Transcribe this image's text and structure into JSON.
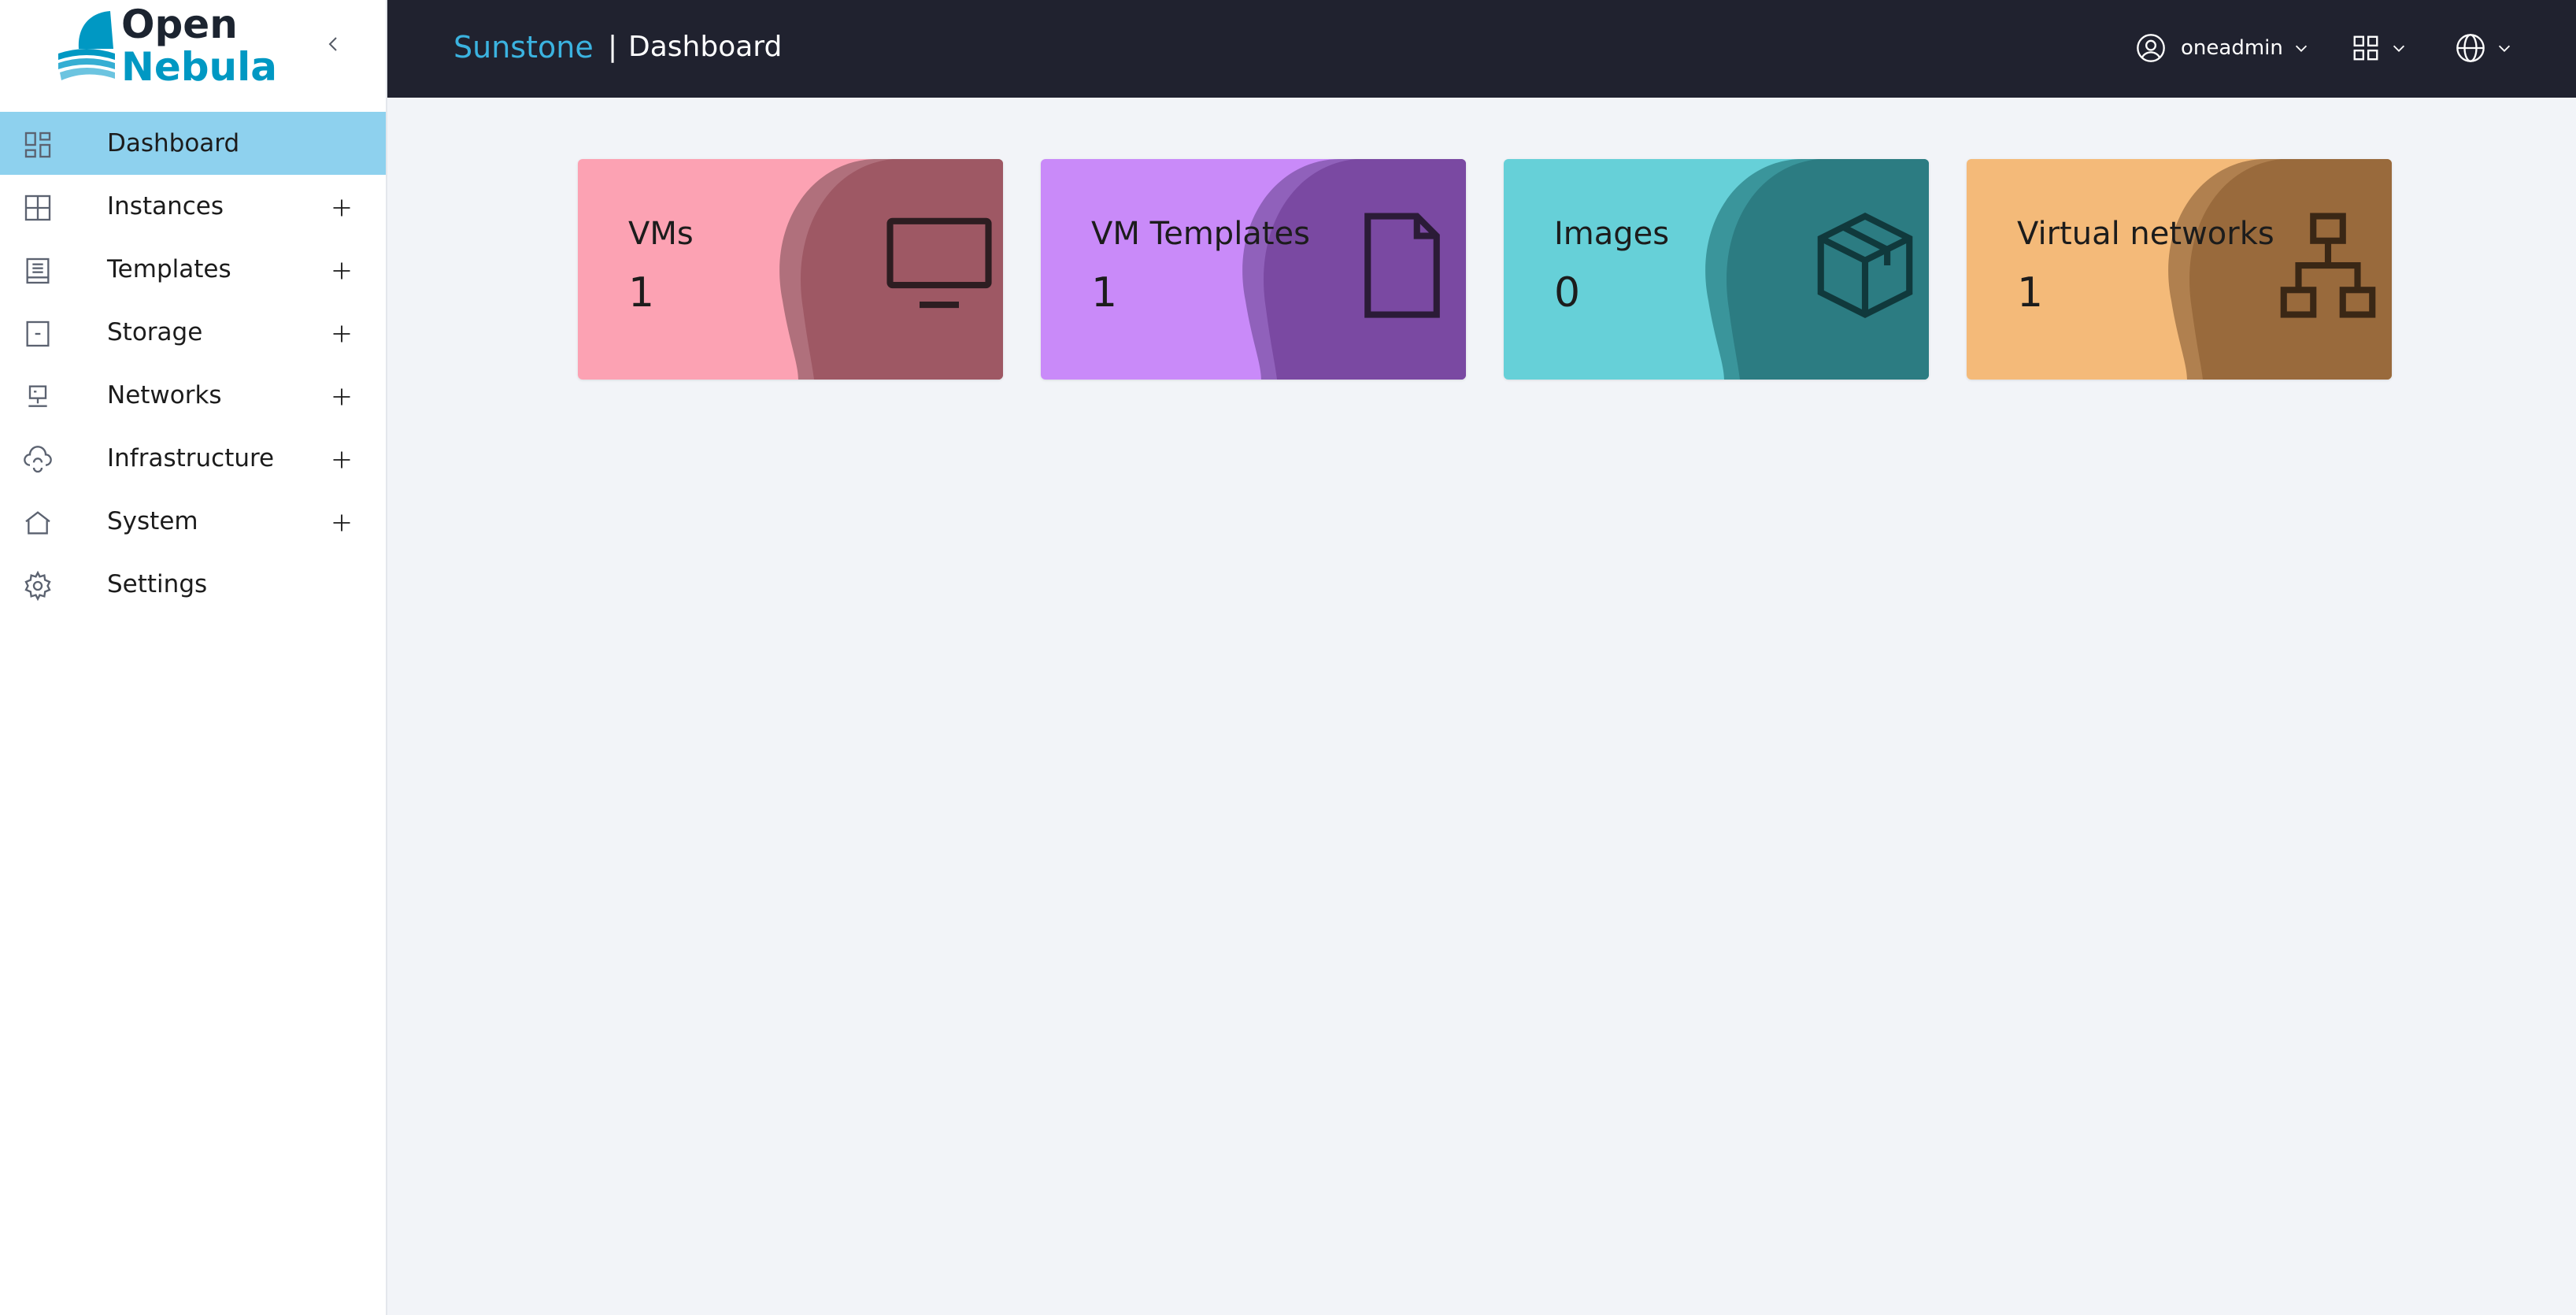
{
  "brand": {
    "logo_line1": "Open",
    "logo_line2": "Nebula",
    "app_name": "Sunstone",
    "separator": "|",
    "page_title": "Dashboard"
  },
  "sidebar": {
    "items": [
      {
        "label": "Dashboard",
        "icon": "dashboard-icon",
        "active": true,
        "expandable": false
      },
      {
        "label": "Instances",
        "icon": "grid-icon",
        "active": false,
        "expandable": true
      },
      {
        "label": "Templates",
        "icon": "templates-icon",
        "active": false,
        "expandable": true
      },
      {
        "label": "Storage",
        "icon": "storage-icon",
        "active": false,
        "expandable": true
      },
      {
        "label": "Networks",
        "icon": "network-icon",
        "active": false,
        "expandable": true
      },
      {
        "label": "Infrastructure",
        "icon": "cloud-sync-icon",
        "active": false,
        "expandable": true
      },
      {
        "label": "System",
        "icon": "home-icon",
        "active": false,
        "expandable": true
      },
      {
        "label": "Settings",
        "icon": "gear-icon",
        "active": false,
        "expandable": false
      }
    ]
  },
  "header": {
    "user_name": "oneadmin"
  },
  "cards": [
    {
      "title": "VMs",
      "count": "1",
      "icon": "monitor-icon",
      "bg": "#fca2b3",
      "accent": "#9e5864",
      "accent2": "#b0707c"
    },
    {
      "title": "VM Templates",
      "count": "1",
      "icon": "file-icon",
      "bg": "#c98af9",
      "accent": "#7a49a2",
      "accent2": "#9061bb"
    },
    {
      "title": "Images",
      "count": "0",
      "icon": "box-icon",
      "bg": "#66d0d8",
      "accent": "#2c7c82",
      "accent2": "#3a959b"
    },
    {
      "title": "Virtual networks",
      "count": "1",
      "icon": "network-tree-icon",
      "bg": "#f4ba79",
      "accent": "#996a3c",
      "accent2": "#b0804f"
    }
  ],
  "colors": {
    "header_bg": "#20222f",
    "sidebar_active": "#8ed1ee",
    "brand_blue": "#3bb3e0",
    "page_bg": "#f2f4f8"
  }
}
